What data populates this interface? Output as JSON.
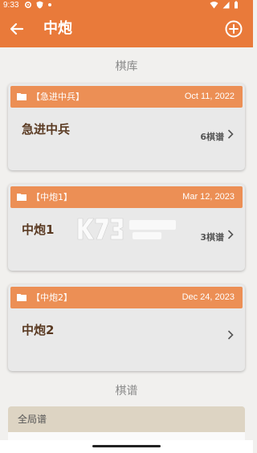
{
  "status": {
    "time": "9:33"
  },
  "appbar": {
    "title": "中炮",
    "back_icon": "arrow-left-icon",
    "add_icon": "plus-circle-icon"
  },
  "library_section": {
    "title": "棋库"
  },
  "cards": [
    {
      "tag": "【急进中兵】",
      "date": "Oct 11, 2022",
      "name": "急进中兵",
      "count": "6棋谱"
    },
    {
      "tag": "【中炮1】",
      "date": "Mar 12, 2023",
      "name": "中炮1",
      "count": "3棋谱"
    },
    {
      "tag": "【中炮2】",
      "date": "Dec 24, 2023",
      "name": "中炮2",
      "count": ""
    }
  ],
  "records_section": {
    "title": "棋谱"
  },
  "records": [
    {
      "label": "全局谱"
    }
  ],
  "colors": {
    "primary": "#e97a3a",
    "card_header": "#ec8f55",
    "record_row": "#ddd4c3"
  }
}
